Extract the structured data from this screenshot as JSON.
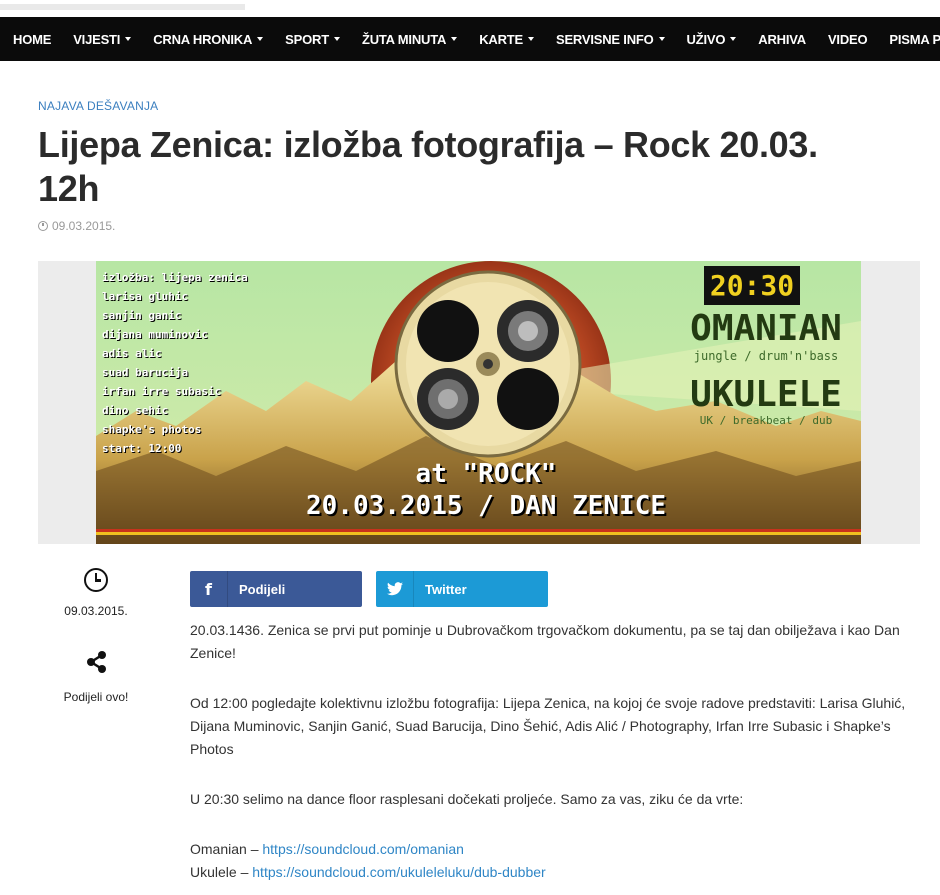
{
  "nav": {
    "items": [
      {
        "label": "HOME",
        "dropdown": false
      },
      {
        "label": "VIJESTI",
        "dropdown": true
      },
      {
        "label": "CRNA HRONIKA",
        "dropdown": true
      },
      {
        "label": "SPORT",
        "dropdown": true
      },
      {
        "label": "ŽUTA MINUTA",
        "dropdown": true
      },
      {
        "label": "KARTE",
        "dropdown": true
      },
      {
        "label": "SERVISNE INFO",
        "dropdown": true
      },
      {
        "label": "UŽIVO",
        "dropdown": true
      },
      {
        "label": "ARHIVA",
        "dropdown": false
      },
      {
        "label": "VIDEO",
        "dropdown": false
      },
      {
        "label": "PISMA PRIJATELJA",
        "dropdown": false
      }
    ]
  },
  "article": {
    "category": "NAJAVA DEŠAVANJA",
    "title": "Lijepa Zenica: izložba fotografija – Rock 20.03. 12h",
    "date": "09.03.2015."
  },
  "poster": {
    "exhibition_lines": [
      "izložba: lijepa zenica",
      "larisa gluhic",
      "sanjin ganic",
      "dijana muminovic",
      "adis alic",
      "suad barucija",
      "irfan irre subasic",
      "dino sehic",
      "shapke's photos",
      "start: 12:00"
    ],
    "time": "20:30",
    "dj1_name": "OMANIAN",
    "dj1_genre": "jungle / drum'n'bass",
    "dj2_name": "UKULELE",
    "dj2_genre": "UK / breakbeat / dub",
    "venue": "at \"ROCK\"",
    "event": "20.03.2015 / DAN ZENICE"
  },
  "sidebar": {
    "date": "09.03.2015.",
    "share_label": "Podijeli ovo!"
  },
  "share": {
    "facebook_label": "Podijeli",
    "twitter_label": "Twitter",
    "facebook_color": "#3b5997",
    "twitter_color": "#1c9ad6"
  },
  "body": {
    "p1": "20.03.1436. Zenica se prvi put pominje u Dubrovačkom trgovačkom dokumentu, pa se taj dan obilježava i kao Dan Zenice!",
    "p2": "Od 12:00 pogledajte kolektivnu izložbu fotografija: Lijepa Zenica, na kojoj će svoje radove predstaviti: Larisa Gluhić, Dijana Muminovic, Sanjin Ganić, Suad Barucija, Dino Šehić, Adis Alić / Photography, Irfan Irre Subasic i Shapke’s Photos",
    "p3": "U 20:30 selimo na dance floor rasplesani dočekati proljeće. Samo za vas, ziku će da vrte:",
    "links": [
      {
        "prefix": "Omanian – ",
        "url": "https://soundcloud.com/omanian"
      },
      {
        "prefix": "Ukulele – ",
        "url": "https://soundcloud.com/ukuleleluku/dub-dubber"
      }
    ]
  }
}
